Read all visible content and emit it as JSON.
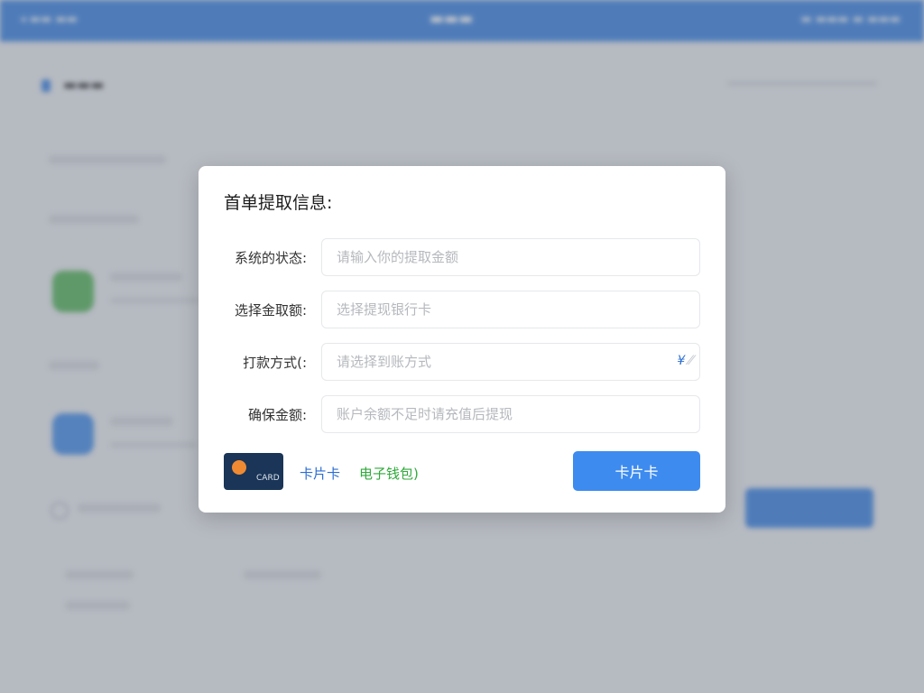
{
  "modal": {
    "title": "首单提取信息:",
    "fields": [
      {
        "label": "系统的状态:",
        "placeholder": "请输入你的提取金额"
      },
      {
        "label": "选择金取额:",
        "placeholder": "选择提现银行卡"
      },
      {
        "label": "打款方式(:",
        "placeholder": "请选择到账方式",
        "suffix": "¥"
      },
      {
        "label": "确保金额:",
        "placeholder": "账户余额不足时请充值后提现"
      }
    ],
    "payment": {
      "card_label": "CARD",
      "bank_link": "卡片卡",
      "ewallet_link": "电子钱包)"
    },
    "submit_label": "卡片卡"
  },
  "colors": {
    "topbar": "#2f7be0",
    "primary_button": "#3d8bef",
    "link_blue": "#2b6ed3",
    "link_green": "#2faa3a",
    "card_bg": "#1a3557",
    "card_chip": "#f08a32"
  }
}
